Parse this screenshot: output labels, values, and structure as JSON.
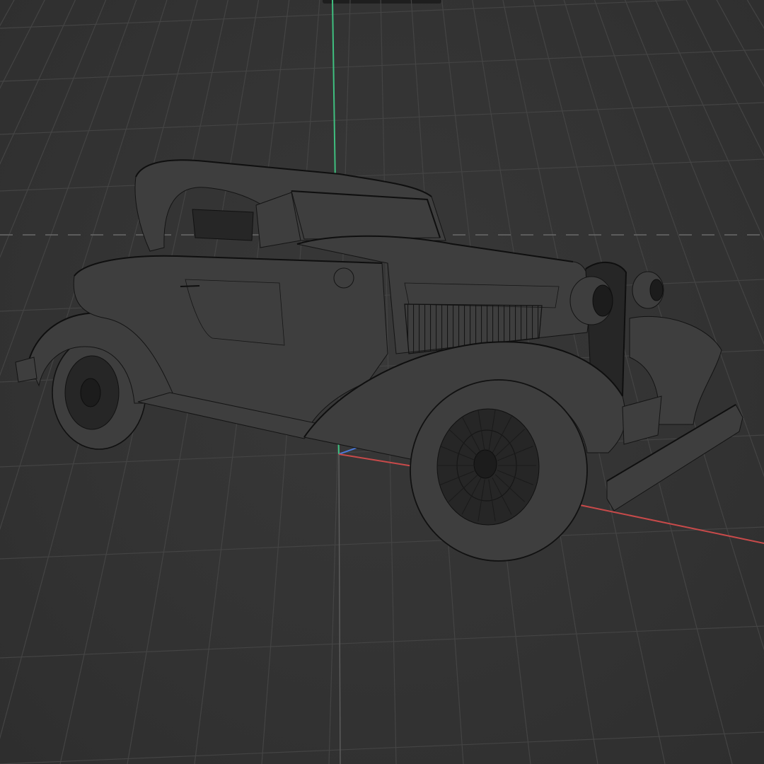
{
  "viewport": {
    "background": "#333333",
    "grid_color": "#444444",
    "axes": {
      "x_color": "#c84a4a",
      "y_color": "#3fbf7f",
      "z_color": "#4a78d8"
    },
    "model": {
      "display_mode": "wireframe",
      "wire_color": "#141414",
      "surface_color": "#3e3e3e"
    }
  }
}
